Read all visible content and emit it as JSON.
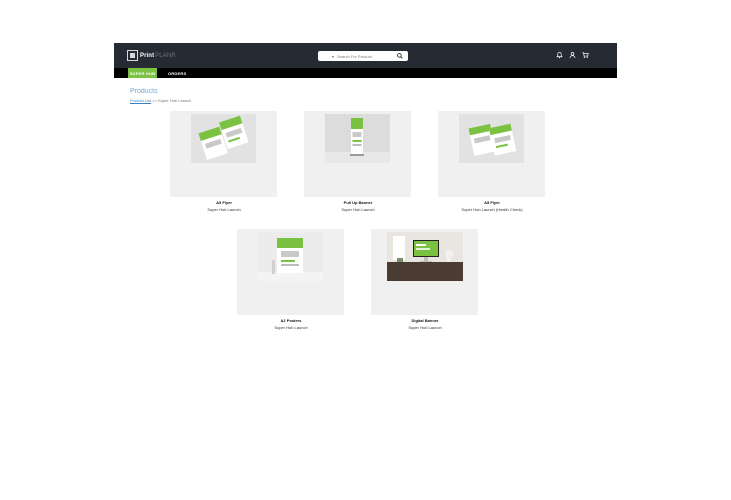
{
  "header": {
    "logo_primary": "Print",
    "logo_secondary": "PLANR",
    "search": {
      "placeholder": "Search For Product"
    }
  },
  "nav": {
    "tabs": [
      {
        "label": "SUPER HUB",
        "active": true
      },
      {
        "label": "ORDERS",
        "active": false
      }
    ]
  },
  "page": {
    "title": "Products",
    "breadcrumb": {
      "link": "Product List",
      "separator": " >> ",
      "current": "Super Hub Launch"
    }
  },
  "products": [
    {
      "name": "A5 Flyer",
      "subtitle": "Super Hub Launch"
    },
    {
      "name": "Pull Up Banner",
      "subtitle": "Super Hub Launch"
    },
    {
      "name": "A5 Flyer",
      "subtitle": "Super Hub Launch (Health Check)"
    },
    {
      "name": "A2 Posters",
      "subtitle": "Super Hub Launch"
    },
    {
      "name": "Digital Banner",
      "subtitle": "Super Hub Launch"
    }
  ],
  "colors": {
    "topbar": "#262b33",
    "active_tab": "#7cc242",
    "title": "#6fa8d6",
    "card_bg": "#f0f0f0"
  }
}
